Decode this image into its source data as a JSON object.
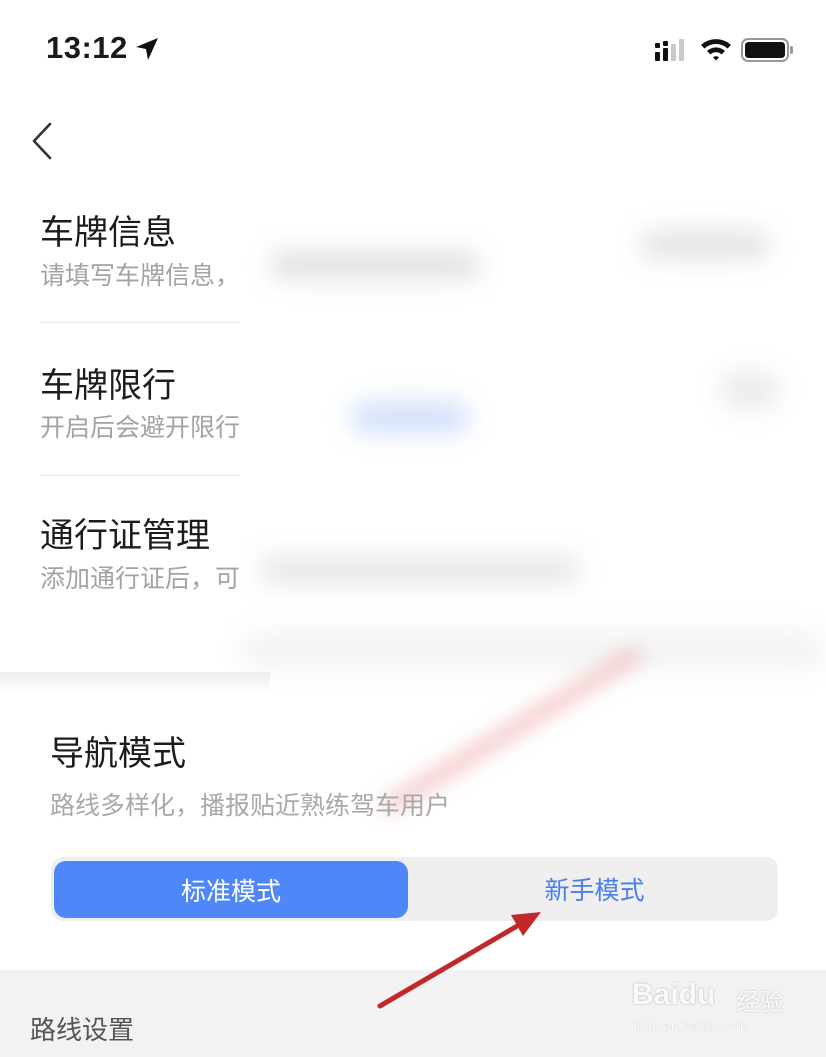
{
  "status_bar": {
    "time": "13:12"
  },
  "icons": {
    "location": "location-arrow-icon",
    "signal": "cellular-signal-icon",
    "wifi": "wifi-icon",
    "battery": "battery-icon",
    "back": "back-chevron-icon"
  },
  "rows": [
    {
      "title": "车牌信息",
      "subtitle": "请填写车牌信息，"
    },
    {
      "title": "车牌限行",
      "subtitle": "开启后会避开限行"
    },
    {
      "title": "通行证管理",
      "subtitle": "添加通行证后，可"
    }
  ],
  "nav_mode": {
    "title": "导航模式",
    "subtitle": "路线多样化，播报贴近熟练驾车用户",
    "options": [
      "标准模式",
      "新手模式"
    ],
    "selected": "标准模式"
  },
  "route_settings": {
    "title": "路线设置"
  },
  "watermark": {
    "brand": "Baidu",
    "cn": "经验",
    "url": "jingyan.baidu.com"
  },
  "colors": {
    "accent": "#4f87f8",
    "annotation_arrow": "#c0282a"
  }
}
